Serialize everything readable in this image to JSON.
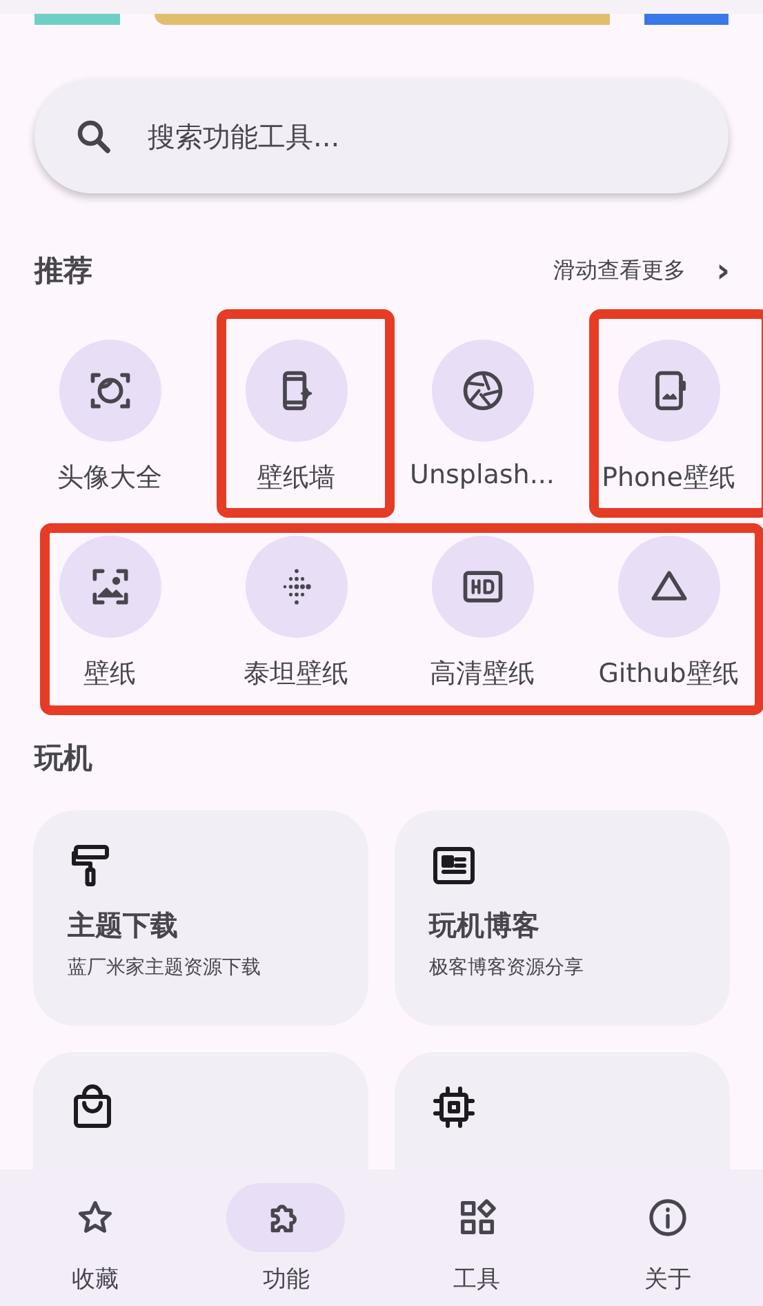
{
  "search": {
    "placeholder": "搜索功能工具..."
  },
  "recommend": {
    "title": "推荐",
    "more": "滑动查看更多",
    "more_arrow": "›",
    "rows": [
      {
        "items": [
          {
            "label": "头像大全",
            "outlined": false
          },
          {
            "label": "壁纸墙",
            "outlined": true
          },
          {
            "label": "Unsplash...",
            "outlined": false
          },
          {
            "label": "Phone壁纸",
            "outlined": true
          }
        ]
      },
      {
        "items": [
          {
            "label": "壁纸",
            "outlined": true
          },
          {
            "label": "泰坦壁纸",
            "outlined": true
          },
          {
            "label": "高清壁纸",
            "outlined": true
          },
          {
            "label": "Github壁纸",
            "outlined": true
          }
        ]
      }
    ]
  },
  "play": {
    "title": "玩机",
    "cards": [
      {
        "kind": "card",
        "title": "主题下载",
        "subtitle": "蓝厂米家主题资源下载"
      },
      {
        "kind": "card",
        "title": "玩机博客",
        "subtitle": "极客博客资源分享"
      },
      {
        "kind": "card"
      },
      {
        "kind": "card"
      }
    ]
  },
  "nav": [
    {
      "label": "收藏",
      "selected": false
    },
    {
      "label": "功能",
      "selected": true
    },
    {
      "label": "工具",
      "selected": false
    },
    {
      "label": "关于",
      "selected": false
    }
  ]
}
